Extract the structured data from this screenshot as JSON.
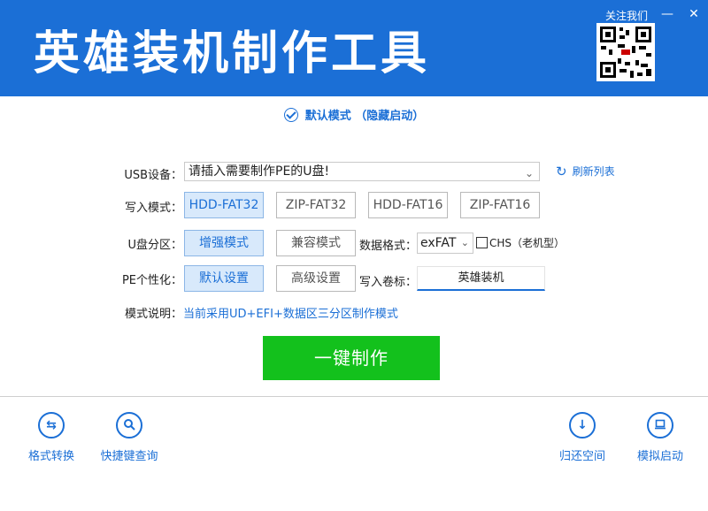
{
  "header": {
    "title": "英雄装机制作工具",
    "follow_label": "关注我们",
    "minimize_icon": "—",
    "close_icon": "✕"
  },
  "mode": {
    "text": "默认模式 （隐藏启动）"
  },
  "usb": {
    "label": "USB设备：",
    "value": "请插入需要制作PE的U盘!",
    "refresh_label": "刷新列表"
  },
  "write_mode": {
    "label": "写入模式：",
    "options": [
      "HDD-FAT32",
      "ZIP-FAT32",
      "HDD-FAT16",
      "ZIP-FAT16"
    ],
    "selected": "HDD-FAT32"
  },
  "partition": {
    "label": "U盘分区：",
    "options": [
      "增强模式",
      "兼容模式"
    ],
    "selected": "增强模式",
    "format_label": "数据格式：",
    "format_value": "exFAT",
    "chs_label": "CHS（老机型）"
  },
  "pe": {
    "label": "PE个性化：",
    "options": [
      "默认设置",
      "高级设置"
    ],
    "selected": "默认设置",
    "volume_label": "写入卷标：",
    "volume_value": "英雄装机"
  },
  "description": {
    "label": "模式说明：",
    "value": "当前采用UD+EFI+数据区三分区制作模式"
  },
  "make_button": "一键制作",
  "tools": [
    {
      "label": "格式转换",
      "icon": "swap-arrows-icon"
    },
    {
      "label": "快捷键查询",
      "icon": "search-icon"
    },
    {
      "label": "归还空间",
      "icon": "download-arrow-icon"
    },
    {
      "label": "模拟启动",
      "icon": "laptop-icon"
    }
  ],
  "colors": {
    "accent": "#1b6fd6",
    "make_button": "#13c11c",
    "active_option_bg": "#d8e9fb"
  }
}
